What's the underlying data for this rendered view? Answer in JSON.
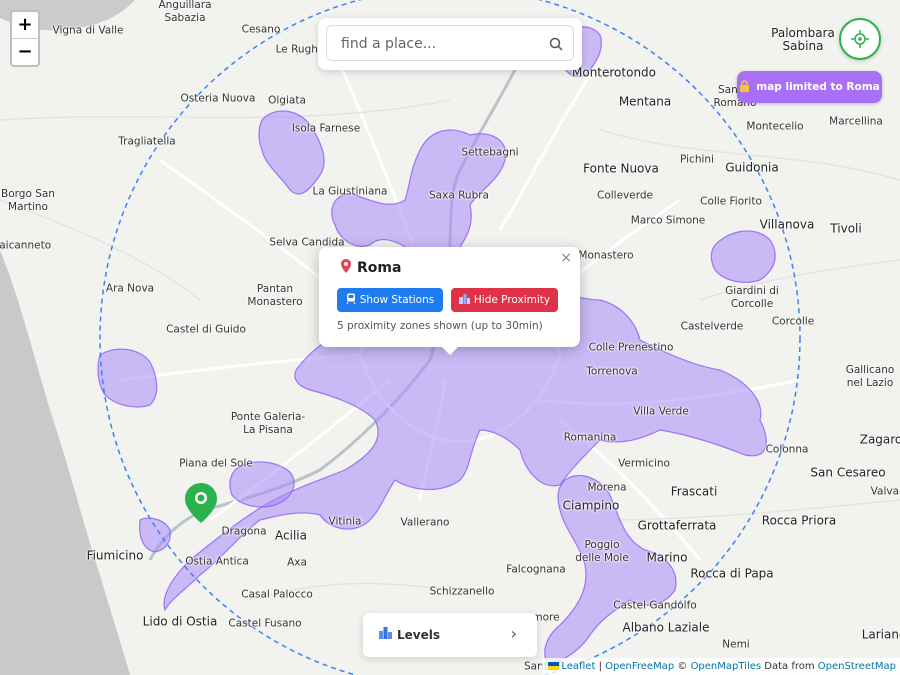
{
  "zoom": {
    "in_label": "+",
    "out_label": "−"
  },
  "search": {
    "placeholder": "find a place...",
    "icon": "search-icon"
  },
  "locate": {
    "icon": "crosshair-icon",
    "color": "#2bb24c"
  },
  "limit_badge": {
    "label": "map limited to Roma",
    "icon": "lock-icon",
    "color": "#a970f5"
  },
  "popup": {
    "title": "Roma",
    "close": "×",
    "show_stations": "Show Stations",
    "hide_proximity": "Hide Proximity",
    "info": "5 proximity zones shown (up to 30min)",
    "colors": {
      "show": "#1f7cf0",
      "hide": "#df3147"
    }
  },
  "levels": {
    "label": "Levels",
    "chevron": "›"
  },
  "attribution": {
    "leaflet": "Leaflet",
    "sep1": " | ",
    "openfreemap": "OpenFreeMap",
    "copy": " © ",
    "omt": "OpenMapTiles",
    "data_from": " Data from ",
    "osm": "OpenStreetMap"
  },
  "map": {
    "proximity_color": "#a78bfa",
    "radius_color": "#3b82f6",
    "places": [
      "Anguillara Sabazia",
      "Cesano",
      "Vigna di Valle",
      "Le Rughe",
      "Palombara Sabina",
      "Monterotondo",
      "Osteria Nuova",
      "Olgiata",
      "Mentana",
      "Sant'Angelo Romano",
      "Montecelio",
      "Marcellina",
      "Tragliatella",
      "Isola Farnese",
      "Settebagni",
      "Fonte Nuova",
      "Pichini",
      "Guidonia",
      "La Giustiniana",
      "Saxa Rubra",
      "Colleverde",
      "Borgo San Martino",
      "Colle Fiorito",
      "Marco Simone",
      "Villanova",
      "Tivoli",
      "Vaicanneto",
      "Selva Candida",
      "Monastero",
      "Ara Nova",
      "Pantan Monastero",
      "Giardini di Corcolle",
      "Castelverde",
      "Corcolle",
      "Castel di Guido",
      "Colle Prenestino",
      "Torrenova",
      "Gallicano nel Lazio",
      "Ponte Galeria-La Pisana",
      "Villa Verde",
      "Zagaro",
      "Romanina",
      "Colonna",
      "Piana del Sole",
      "Vermicino",
      "San Cesareo",
      "Morena",
      "Frascati",
      "Valvar",
      "Ciampino",
      "Vitinia",
      "Vallerano",
      "Rocca Priora",
      "Dragona",
      "Acilia",
      "Grottaferrata",
      "Fiumicino",
      "Poggio delle Mole",
      "Marino",
      "Ostia Antica",
      "Axa",
      "Falcognana",
      "Rocca di Papa",
      "Casal Palocco",
      "Schizzanello",
      "Lido di Ostia",
      "Castel Fusano",
      "Castel Gandolfo",
      "Albano Laziale",
      "Nemi",
      "Lariano",
      "Santa P",
      "more"
    ]
  }
}
